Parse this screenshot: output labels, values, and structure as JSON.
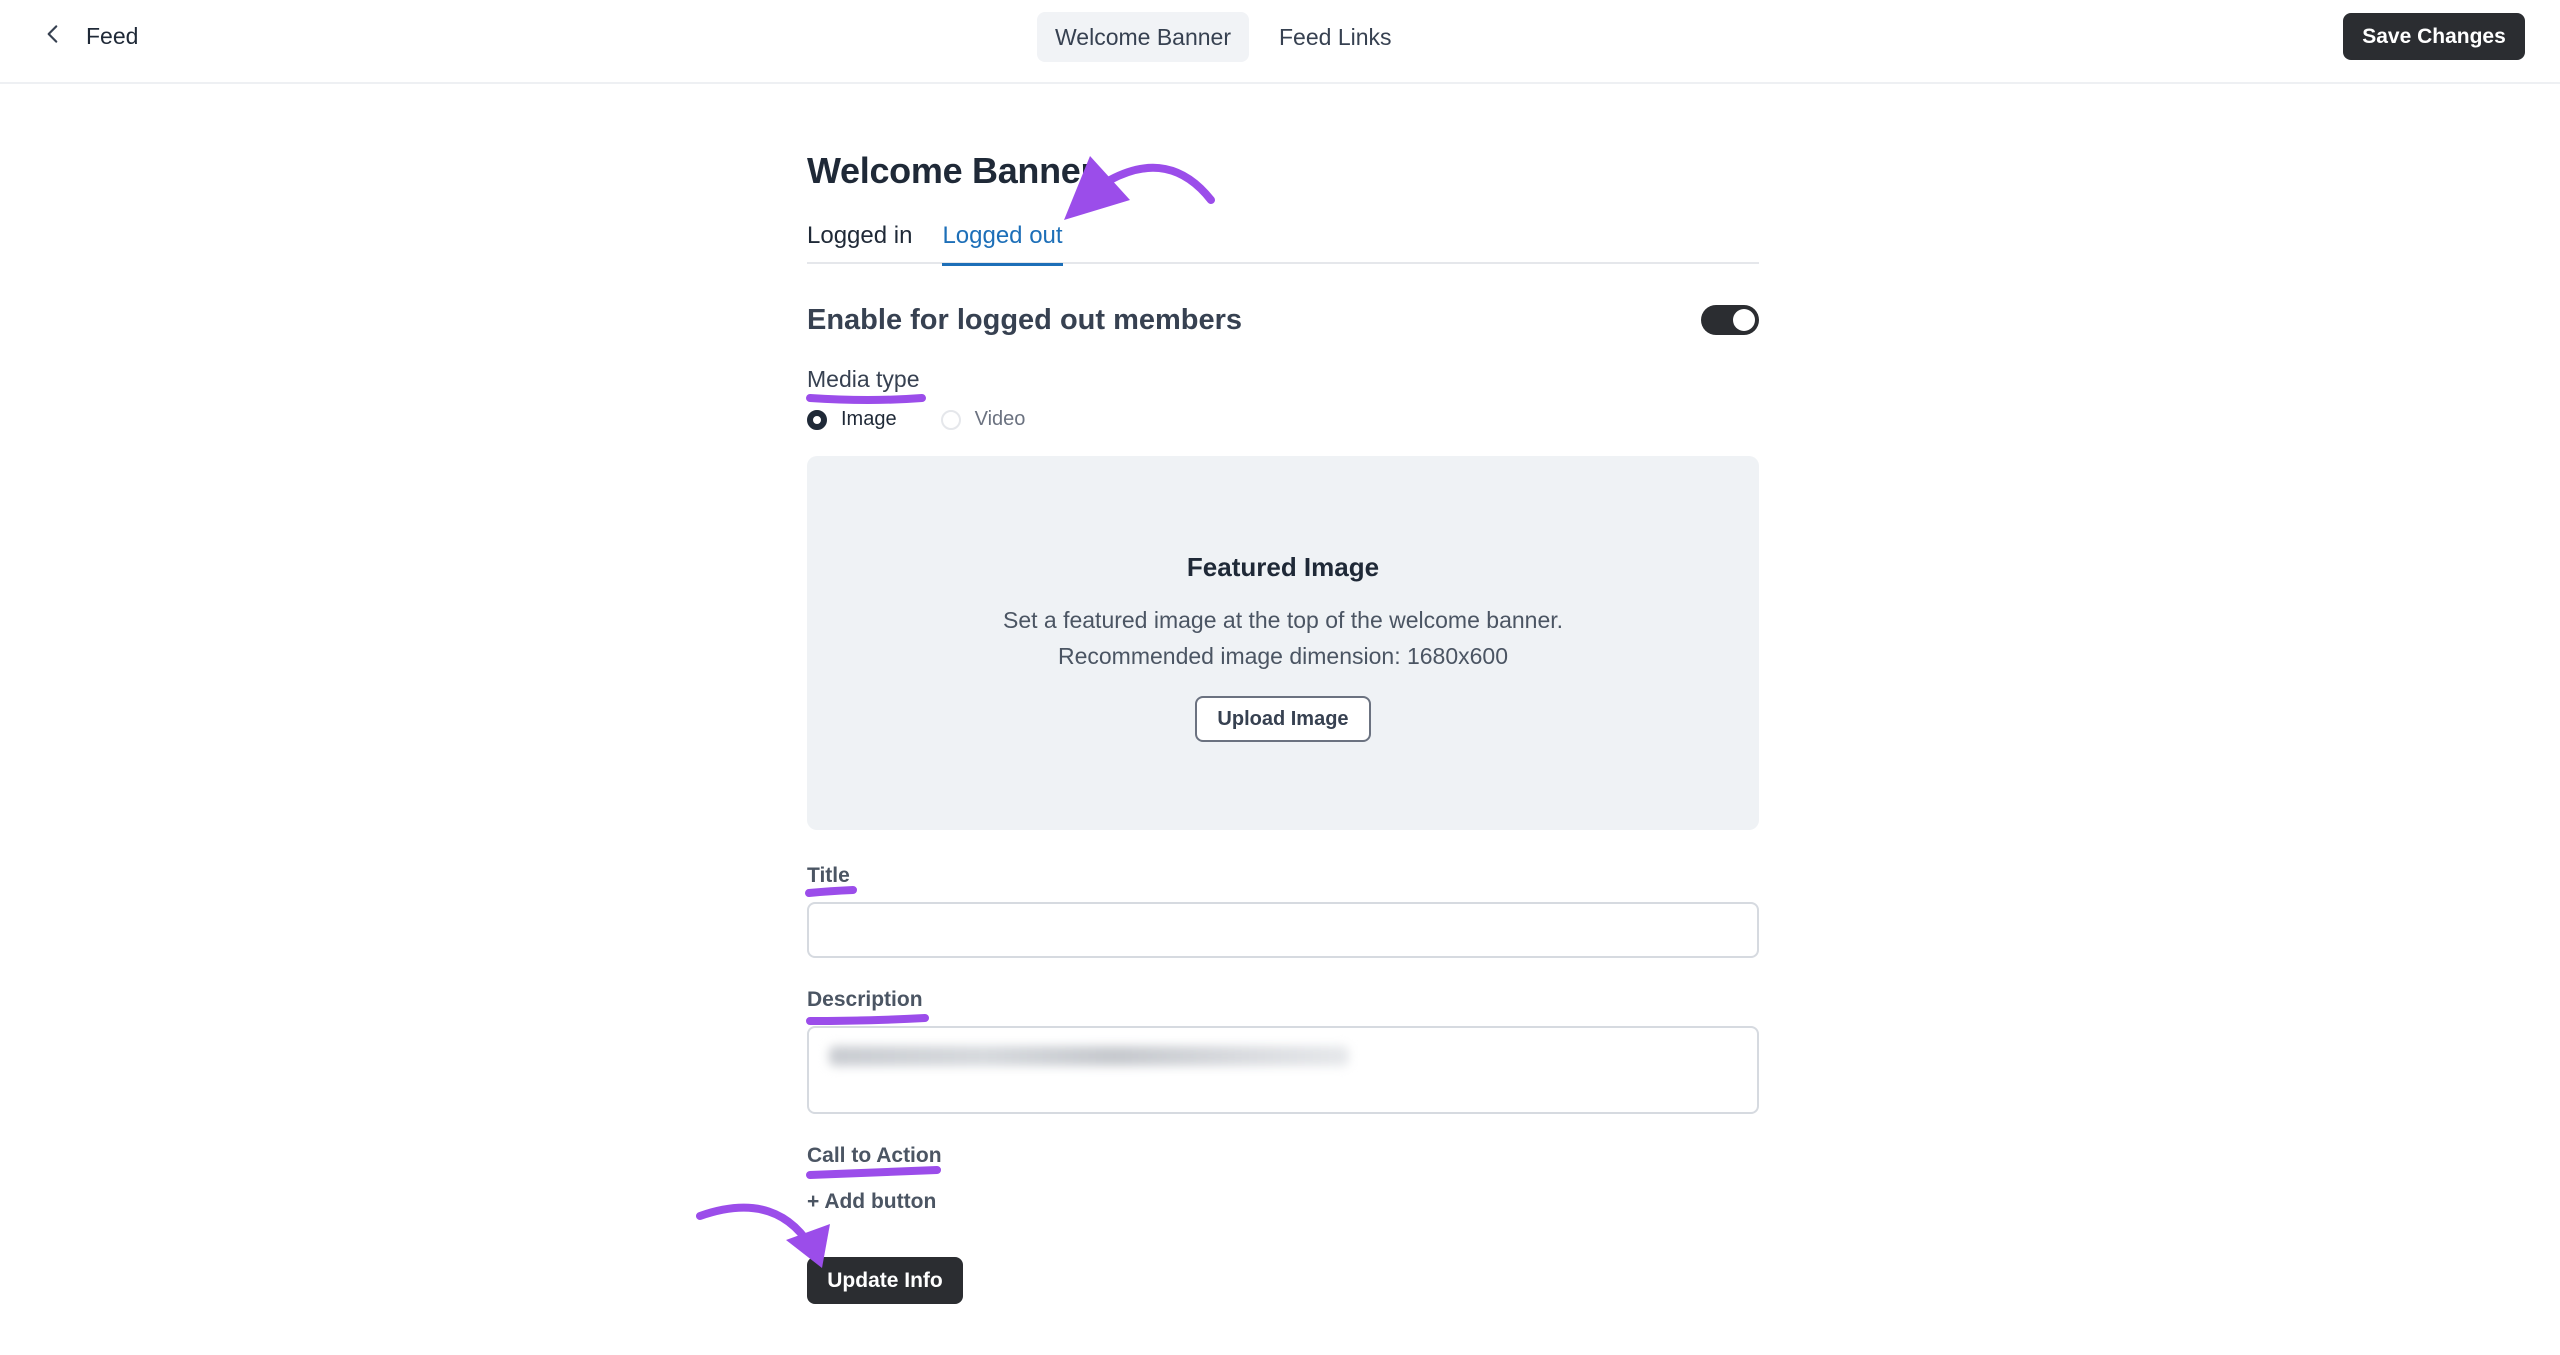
{
  "header": {
    "back_label": "Feed",
    "tabs": [
      {
        "label": "Welcome Banner",
        "active": true
      },
      {
        "label": "Feed Links",
        "active": false
      }
    ],
    "save_label": "Save Changes"
  },
  "main": {
    "title": "Welcome Banner",
    "sub_tabs": [
      {
        "label": "Logged in",
        "active": false
      },
      {
        "label": "Logged out",
        "active": true
      }
    ],
    "enable_label": "Enable for logged out members",
    "enable_on": true,
    "media_type": {
      "label": "Media type",
      "options": [
        {
          "label": "Image",
          "selected": true
        },
        {
          "label": "Video",
          "selected": false
        }
      ]
    },
    "featured_image": {
      "title": "Featured Image",
      "desc_line1": "Set a featured image at the top of the welcome banner.",
      "desc_line2": "Recommended image dimension: 1680x600",
      "upload_label": "Upload Image"
    },
    "title_field": {
      "label": "Title",
      "value": ""
    },
    "description_field": {
      "label": "Description"
    },
    "cta": {
      "label": "Call to Action",
      "add_label": "+ Add button"
    },
    "update_label": "Update Info"
  },
  "colors": {
    "primary_dark": "#2b2d31",
    "active_tab": "#1d6fb8",
    "annotation": "#9b4dea",
    "upload_bg": "#eff2f5"
  }
}
